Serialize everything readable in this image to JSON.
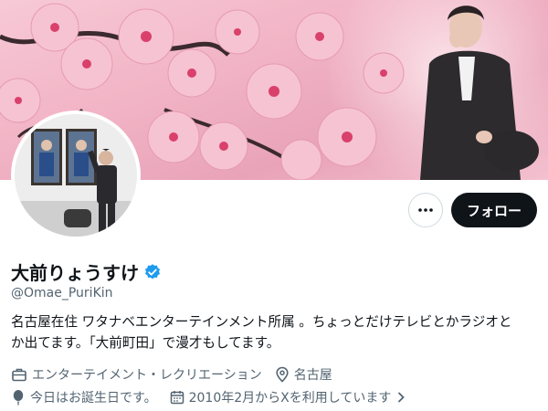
{
  "profile": {
    "display_name": "大前りょうすけ",
    "handle": "@Omae_PuriKin",
    "bio_line1": "名古屋在住 ワタナベエンターテインメント所属 。ちょっとだけテレビとかラジオと",
    "bio_line2": "か出てます。「大前町田」で漫才もしてます。",
    "category": "エンターテイメント・レクリエーション",
    "location": "名古屋",
    "birthday": "今日はお誕生日です。",
    "joined": "2010年2月からXを利用しています"
  },
  "actions": {
    "follow_label": "フォロー"
  },
  "icons": {
    "verified": "verified-badge-icon",
    "more": "more-icon",
    "category": "briefcase-icon",
    "location": "location-pin-icon",
    "birthday": "balloon-icon",
    "joined": "calendar-icon",
    "chevron": "chevron-right-icon"
  },
  "colors": {
    "verified_blue": "#1d9bf0",
    "follow_bg": "#0f1419",
    "muted_text": "#536471"
  }
}
